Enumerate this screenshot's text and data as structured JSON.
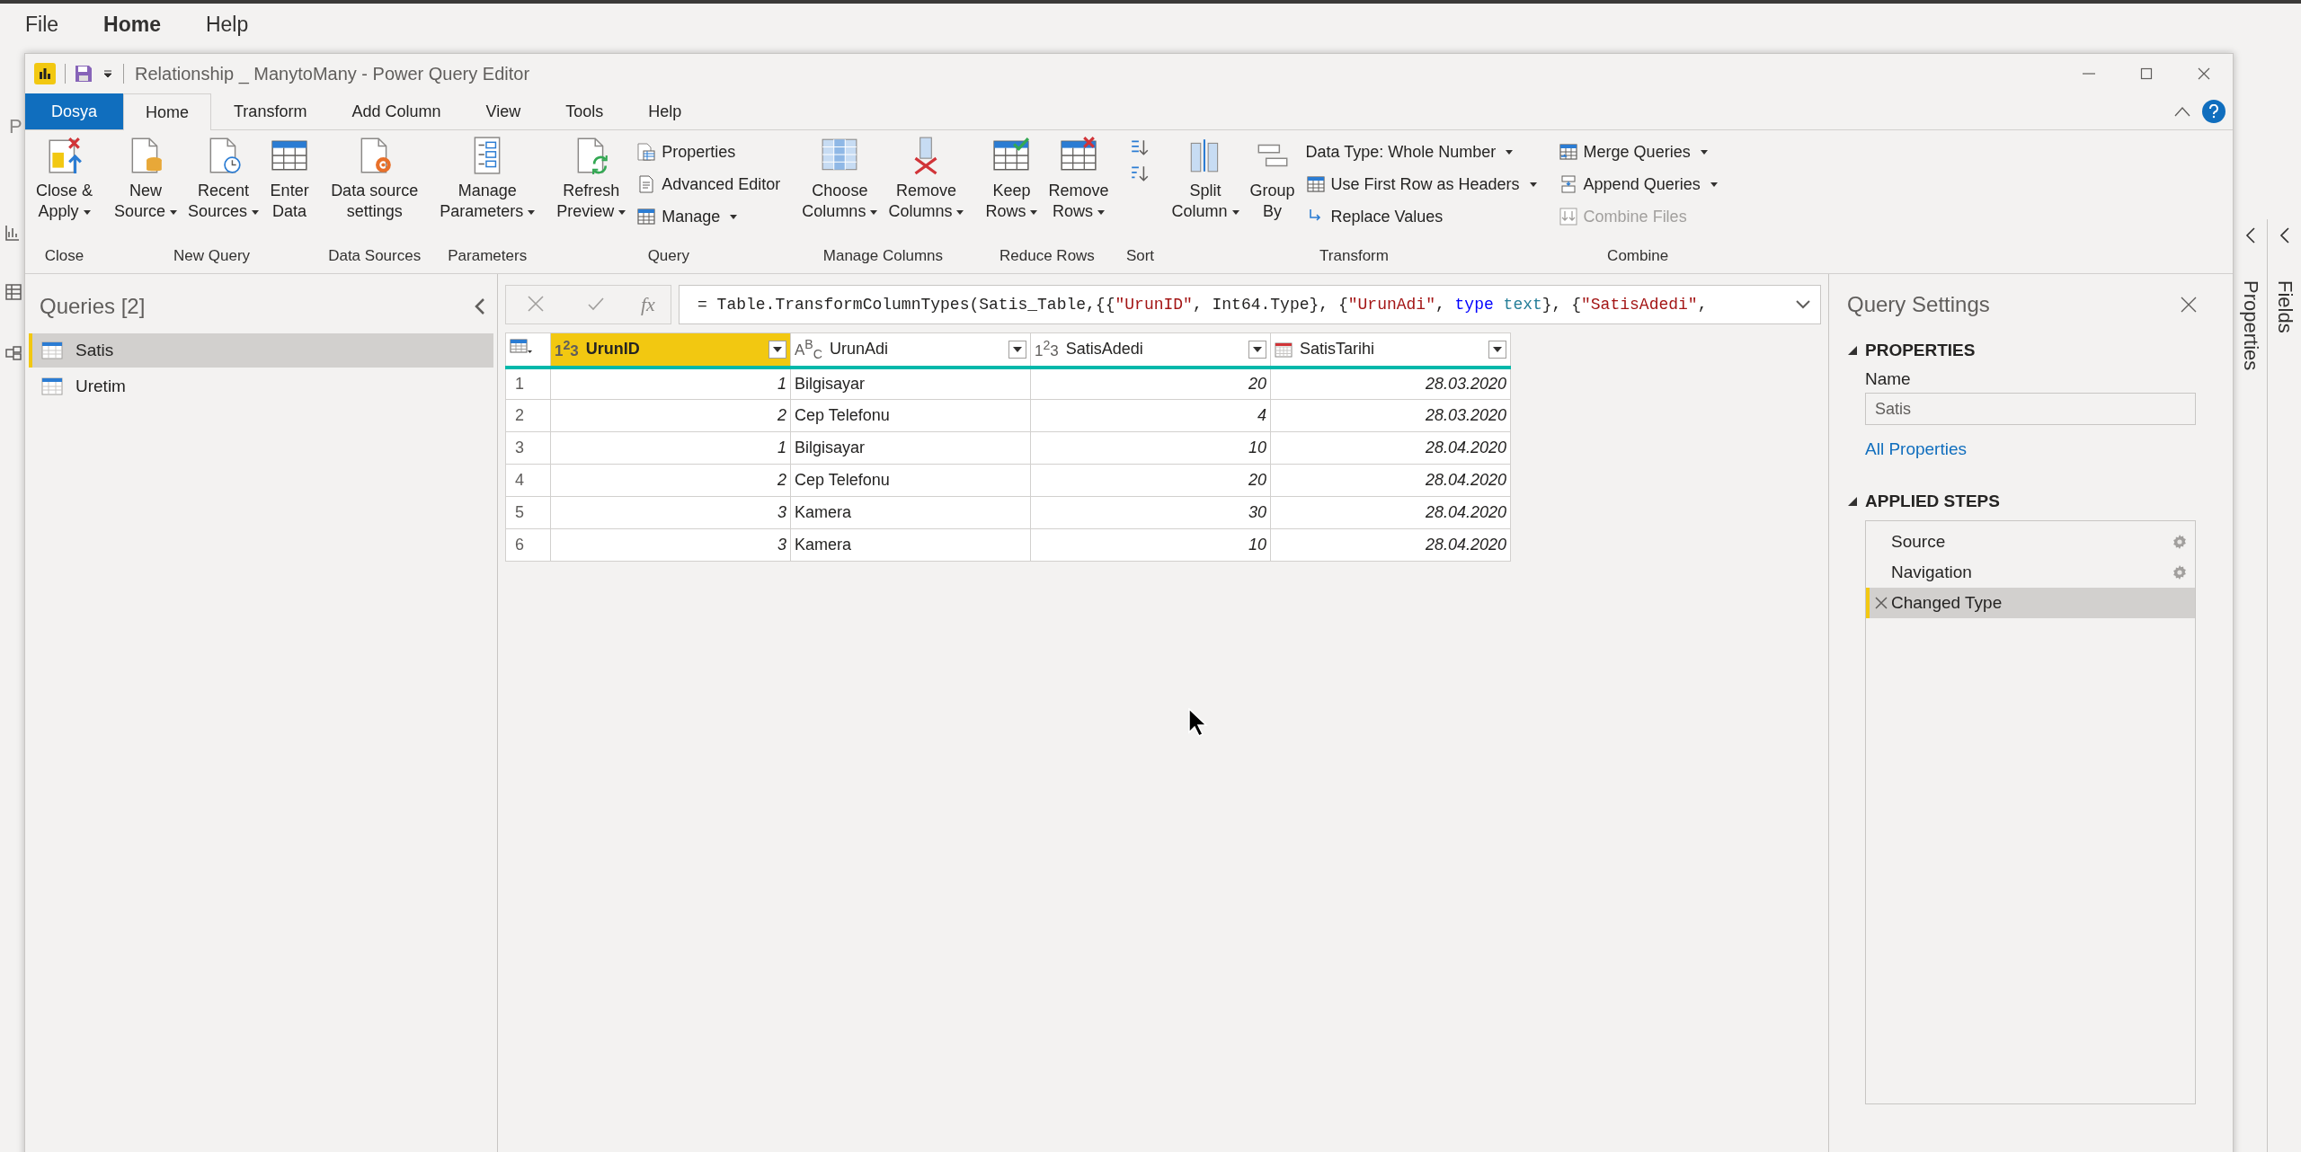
{
  "app_menu": [
    {
      "label": "File",
      "selected": false
    },
    {
      "label": "Home",
      "selected": true
    },
    {
      "label": "Help",
      "selected": false
    }
  ],
  "background_fragment": "P",
  "window": {
    "title": "Relationship _ ManytoMany - Power Query Editor"
  },
  "tabs": [
    {
      "label": "Dosya",
      "kind": "file",
      "selected": false
    },
    {
      "label": "Home",
      "kind": "tab",
      "selected": true
    },
    {
      "label": "Transform",
      "kind": "tab",
      "selected": false
    },
    {
      "label": "Add Column",
      "kind": "tab",
      "selected": false
    },
    {
      "label": "View",
      "kind": "tab",
      "selected": false
    },
    {
      "label": "Tools",
      "kind": "tab",
      "selected": false
    },
    {
      "label": "Help",
      "kind": "tab",
      "selected": false
    }
  ],
  "ribbon": [
    {
      "label": "Close",
      "buttons": [
        {
          "kind": "large",
          "label": "Close &\nApply",
          "dropdown": true
        }
      ]
    },
    {
      "label": "New Query",
      "buttons": [
        {
          "kind": "large",
          "label": "New\nSource",
          "dropdown": true
        },
        {
          "kind": "large",
          "label": "Recent\nSources",
          "dropdown": true
        },
        {
          "kind": "large",
          "label": "Enter\nData",
          "dropdown": false
        }
      ]
    },
    {
      "label": "Data Sources",
      "buttons": [
        {
          "kind": "large",
          "label": "Data source\nsettings",
          "dropdown": false
        }
      ]
    },
    {
      "label": "Parameters",
      "buttons": [
        {
          "kind": "large",
          "label": "Manage\nParameters",
          "dropdown": true
        }
      ]
    },
    {
      "label": "Query",
      "buttons": [
        {
          "kind": "large",
          "label": "Refresh\nPreview",
          "dropdown": true
        },
        {
          "kind": "small",
          "label": "Properties",
          "dropdown": false
        },
        {
          "kind": "small",
          "label": "Advanced Editor",
          "dropdown": false
        },
        {
          "kind": "small",
          "label": "Manage",
          "dropdown": true
        }
      ]
    },
    {
      "label": "Manage Columns",
      "buttons": [
        {
          "kind": "large",
          "label": "Choose\nColumns",
          "dropdown": true
        },
        {
          "kind": "large",
          "label": "Remove\nColumns",
          "dropdown": true
        }
      ]
    },
    {
      "label": "Reduce Rows",
      "buttons": [
        {
          "kind": "large",
          "label": "Keep\nRows",
          "dropdown": true
        },
        {
          "kind": "large",
          "label": "Remove\nRows",
          "dropdown": true
        }
      ]
    },
    {
      "label": "Sort",
      "buttons": [
        {
          "kind": "icon",
          "dropdown": false
        },
        {
          "kind": "icon",
          "dropdown": false
        }
      ]
    },
    {
      "label": "Transform",
      "buttons": [
        {
          "kind": "large",
          "label": "Split\nColumn",
          "dropdown": true
        },
        {
          "kind": "large",
          "label": "Group\nBy",
          "dropdown": false
        },
        {
          "kind": "small",
          "label": "Data Type: Whole Number",
          "dropdown": true
        },
        {
          "kind": "small",
          "label": "Use First Row as Headers",
          "dropdown": true
        },
        {
          "kind": "small",
          "label": "Replace Values",
          "dropdown": false
        }
      ]
    },
    {
      "label": "Combine",
      "buttons": [
        {
          "kind": "small",
          "label": "Merge Queries",
          "dropdown": true,
          "disabled": false
        },
        {
          "kind": "small",
          "label": "Append Queries",
          "dropdown": true,
          "disabled": false
        },
        {
          "kind": "small",
          "label": "Combine Files",
          "dropdown": false,
          "disabled": true
        }
      ]
    }
  ],
  "queries": {
    "title": "Queries [2]",
    "items": [
      {
        "label": "Satis",
        "selected": true
      },
      {
        "label": "Uretim",
        "selected": false
      }
    ]
  },
  "formula_bar": {
    "function_label": "fx",
    "formula": [
      {
        "kind": "plain",
        "text": "= Table.TransformColumnTypes(Satis_Table,{{"
      },
      {
        "kind": "string",
        "text": "\"UrunID\""
      },
      {
        "kind": "plain",
        "text": ", Int64.Type}, {"
      },
      {
        "kind": "string",
        "text": "\"UrunAdi\""
      },
      {
        "kind": "plain",
        "text": ", "
      },
      {
        "kind": "keyword",
        "text": "type"
      },
      {
        "kind": "type",
        "text": " text"
      },
      {
        "kind": "plain",
        "text": "}, {"
      },
      {
        "kind": "string",
        "text": "\"SatisAdedi\""
      },
      {
        "kind": "plain",
        "text": ","
      }
    ]
  },
  "table": {
    "columns": [
      {
        "name": "UrunID",
        "kind": "number",
        "type_label": "1$^{2}$3",
        "selected": true
      },
      {
        "name": "UrunAdi",
        "kind": "text",
        "type_label": "A$^{B}$$_{C}$",
        "selected": false
      },
      {
        "name": "SatisAdedi",
        "kind": "number",
        "type_label": "1$^{2}$3",
        "selected": false
      },
      {
        "name": "SatisTarihi",
        "kind": "date",
        "selected": false
      }
    ],
    "rows": [
      {
        "number": "1",
        "cells": [
          "1",
          "Bilgisayar",
          "20",
          "28.03.2020"
        ]
      },
      {
        "number": "2",
        "cells": [
          "2",
          "Cep Telefonu",
          "4",
          "28.03.2020"
        ]
      },
      {
        "number": "3",
        "cells": [
          "1",
          "Bilgisayar",
          "10",
          "28.04.2020"
        ]
      },
      {
        "number": "4",
        "cells": [
          "2",
          "Cep Telefonu",
          "20",
          "28.04.2020"
        ]
      },
      {
        "number": "5",
        "cells": [
          "3",
          "Kamera",
          "30",
          "28.04.2020"
        ]
      },
      {
        "number": "6",
        "cells": [
          "3",
          "Kamera",
          "10",
          "28.04.2020"
        ]
      }
    ]
  },
  "query_settings": {
    "title": "Query Settings",
    "sections": [
      {
        "heading": "PROPERTIES",
        "expanded": true,
        "name_label": "Name",
        "name_value": "Satis",
        "link": "All Properties"
      },
      {
        "heading": "APPLIED STEPS",
        "expanded": true,
        "steps": [
          {
            "label": "Source",
            "settings": true,
            "selected": false
          },
          {
            "label": "Navigation",
            "settings": true,
            "selected": false
          },
          {
            "label": "Changed Type",
            "settings": false,
            "selected": true
          }
        ]
      }
    ]
  },
  "side_panes": [
    {
      "label": "Properties"
    },
    {
      "label": "Fields"
    }
  ]
}
